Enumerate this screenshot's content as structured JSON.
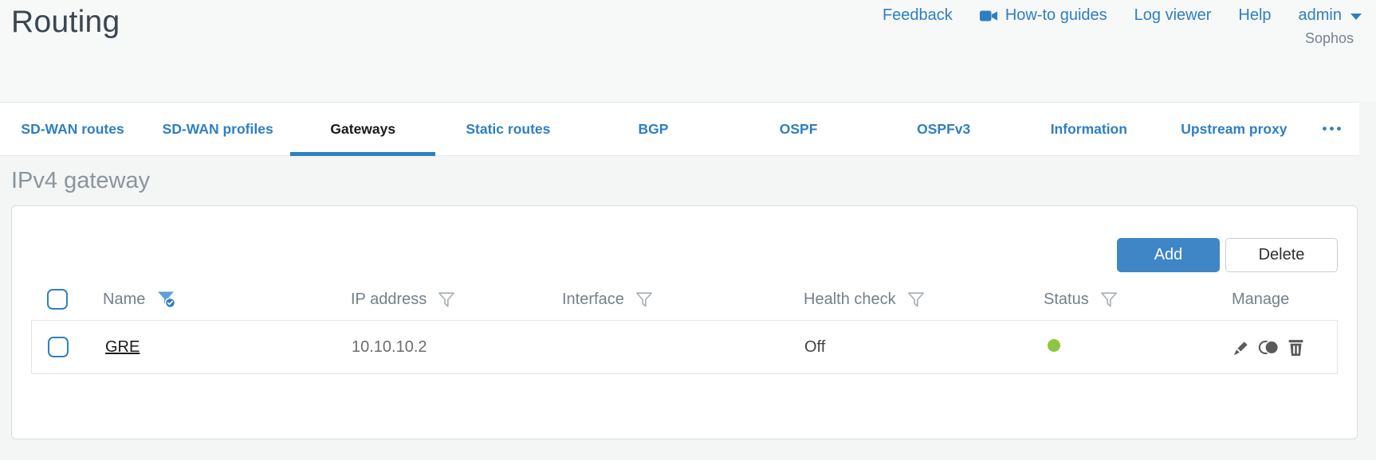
{
  "header": {
    "title": "Routing",
    "nav": {
      "feedback": "Feedback",
      "howto_guides": "How-to guides",
      "log_viewer": "Log viewer",
      "help": "Help",
      "user": "admin",
      "brand": "Sophos"
    }
  },
  "tabs": {
    "items": [
      {
        "label": "SD-WAN routes",
        "active": false
      },
      {
        "label": "SD-WAN profiles",
        "active": false
      },
      {
        "label": "Gateways",
        "active": true
      },
      {
        "label": "Static routes",
        "active": false
      },
      {
        "label": "BGP",
        "active": false
      },
      {
        "label": "OSPF",
        "active": false
      },
      {
        "label": "OSPFv3",
        "active": false
      },
      {
        "label": "Information",
        "active": false
      },
      {
        "label": "Upstream proxy",
        "active": false
      }
    ],
    "overflow": "•••"
  },
  "section": {
    "heading": "IPv4 gateway"
  },
  "toolbar": {
    "add_label": "Add",
    "delete_label": "Delete"
  },
  "table": {
    "columns": [
      {
        "label": "Name",
        "filter": "active"
      },
      {
        "label": "IP address",
        "filter": "default"
      },
      {
        "label": "Interface",
        "filter": "default"
      },
      {
        "label": "Health check",
        "filter": "default"
      },
      {
        "label": "Status",
        "filter": "default"
      },
      {
        "label": "Manage",
        "filter": "none"
      }
    ],
    "rows": [
      {
        "name": "GRE",
        "ip_address": "10.10.10.2",
        "interface": "",
        "health_check": "Off",
        "status": "up",
        "status_color": "#8cc63e",
        "manage_icons": [
          "edit",
          "clone",
          "delete"
        ]
      }
    ]
  },
  "colors": {
    "accent_blue": "#2e7fc2",
    "button_blue": "#3e86c6",
    "status_green": "#8cc63e",
    "icon_gray": "#5a5a5a"
  }
}
